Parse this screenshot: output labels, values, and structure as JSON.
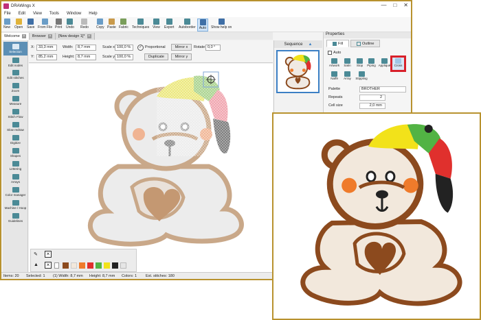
{
  "window": {
    "title": "DRAWings X"
  },
  "menu": [
    "File",
    "Edit",
    "View",
    "Tools",
    "Window",
    "Help"
  ],
  "toolbar": [
    {
      "label": "New",
      "icon": "new-file-icon"
    },
    {
      "label": "Open",
      "icon": "open-folder-icon"
    },
    {
      "label": "Save",
      "icon": "save-icon"
    },
    {
      "label": "From File",
      "icon": "from-file-icon"
    },
    {
      "label": "Print",
      "icon": "print-icon"
    },
    {
      "label": "Undo",
      "icon": "undo-icon"
    },
    {
      "label": "Redo",
      "icon": "redo-icon"
    },
    {
      "label": "Copy",
      "icon": "copy-icon"
    },
    {
      "label": "Paste",
      "icon": "paste-icon"
    },
    {
      "label": "Fabric",
      "icon": "fabric-icon"
    },
    {
      "label": "Techniques",
      "icon": "techniques-icon"
    },
    {
      "label": "View",
      "icon": "view-icon"
    },
    {
      "label": "Export",
      "icon": "export-icon"
    },
    {
      "label": "Autoborder",
      "icon": "autoborder-icon"
    },
    {
      "label": "Auto",
      "icon": "auto-icon"
    },
    {
      "label": "Show help on",
      "icon": "help-icon"
    }
  ],
  "doc_tabs": [
    "Welcome",
    "Browser",
    "[New design 1]*"
  ],
  "sidebar": [
    "Selection",
    "Edit nodes",
    "Edit stitches",
    "Zoom",
    "Measure",
    "Stitch Flow",
    "Slow redraw",
    "Digitize",
    "Shapes",
    "Lettering",
    "Arrays",
    "Color manager",
    "Machine / Hoop",
    "Guidelines"
  ],
  "props": {
    "x_label": "X:",
    "x_value": "33,3 mm",
    "y_label": "Y:",
    "y_value": "85,2 mm",
    "width_label": "Width:",
    "width_value": "8,7 mm",
    "height_label": "Height:",
    "height_value": "8,7 mm",
    "scale_x_label": "Scale x:",
    "scale_x_value": "100,0 %",
    "scale_y_label": "Scale y:",
    "scale_y_value": "100,0 %",
    "proportional": "Proportional",
    "mirror_x": "Mirror x",
    "mirror_y": "Mirror y",
    "duplicate": "Duplicate",
    "rotate_label": "Rotate:",
    "rotate_value": "0,0 °"
  },
  "sequence": {
    "title": "Sequence"
  },
  "properties": {
    "title": "Properties",
    "tabs": [
      "Fill",
      "Outline"
    ],
    "auto_label": "Auto",
    "fill_types": [
      "Artwork",
      "Satin",
      "Stop",
      "Piping",
      "Appliqué",
      "Cross",
      "Nalf9",
      "Array",
      "Stippling"
    ],
    "palette_label": "Palette",
    "palette_value": "BROTHER",
    "repeats_label": "Repeats",
    "repeats_value": "2",
    "cell_label": "Cell size",
    "cell_value": "2,0 mm"
  },
  "status": {
    "items": "Items: 20",
    "selected": "Selected: 1",
    "width": "(1) Width: 8,7 mm",
    "height": "Height: 8,7 mm",
    "colors": "Colors: 1",
    "stitches": "Est. stitches: 180"
  },
  "colors": {
    "accent": "#b8922e",
    "highlight": "#d8202a",
    "brown": "#8c4a1e",
    "cap_yellow": "#f2e21a",
    "cap_green": "#52b344",
    "cap_red": "#e0302d",
    "cheek": "#ef7b2b"
  }
}
